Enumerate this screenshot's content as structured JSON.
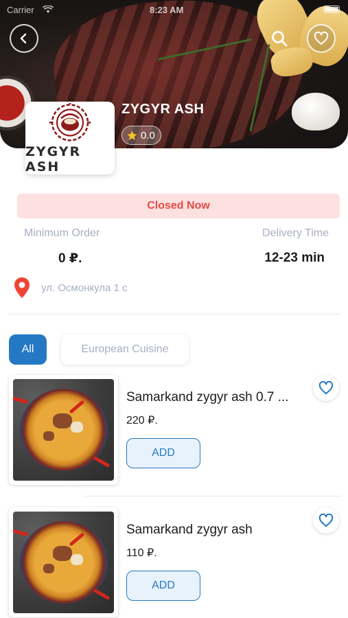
{
  "status_bar": {
    "carrier": "Carrier",
    "time": "8:23 AM"
  },
  "restaurant": {
    "name": "ZYGYR ASH",
    "rating": "0.0",
    "logo_text": "ZYGYR ASH"
  },
  "status": {
    "closed_label": "Closed Now"
  },
  "info": {
    "min_order_label": "Minimum Order",
    "min_order_value": "0 ₽.",
    "delivery_label": "Delivery Time",
    "delivery_value": "12-23 min",
    "address": "ул. Осмонкула 1 с"
  },
  "categories": [
    {
      "label": "All",
      "active": true
    },
    {
      "label": "European Cuisine",
      "active": false
    }
  ],
  "products": [
    {
      "title": "Samarkand zygyr ash 0.7 ...",
      "price": "220 ₽.",
      "add_label": "ADD"
    },
    {
      "title": "Samarkand zygyr ash",
      "price": "110 ₽.",
      "add_label": "ADD"
    }
  ],
  "icons": [
    "back-icon",
    "search-icon",
    "heart-icon",
    "star-icon",
    "location-pin-icon",
    "wifi-icon",
    "battery-icon"
  ],
  "colors": {
    "accent": "#2478c4",
    "closed_bg": "#fde0e0",
    "closed_text": "#e54c45",
    "muted": "#a7afc2"
  }
}
